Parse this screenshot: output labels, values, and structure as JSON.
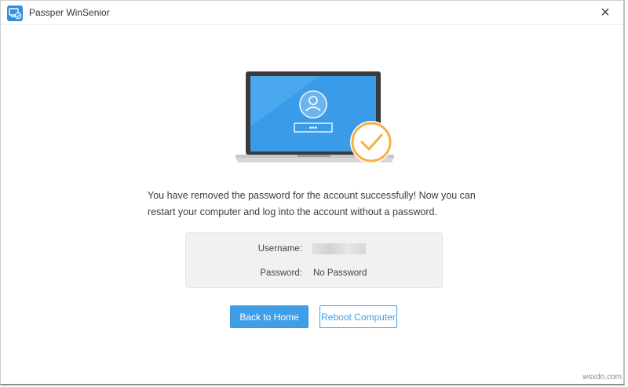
{
  "window": {
    "title": "Passper WinSenior",
    "close_glyph": "×"
  },
  "illustration": {
    "password_dots": "•••",
    "accent": "#f5b041",
    "screen_color": "#3a9be8"
  },
  "message": {
    "line1": "You have removed the password for the account successfully! Now you can",
    "line2": "restart your computer and log into the account without a password."
  },
  "account_info": {
    "username_label": "Username:",
    "password_label": "Password:",
    "password_value": "No Password"
  },
  "actions": {
    "back_label": "Back to Home",
    "reboot_label": "Reboot Computer"
  },
  "watermark": "wsxdn.com",
  "colors": {
    "primary": "#3f9ee8",
    "panel_bg": "#f1f1f1"
  }
}
